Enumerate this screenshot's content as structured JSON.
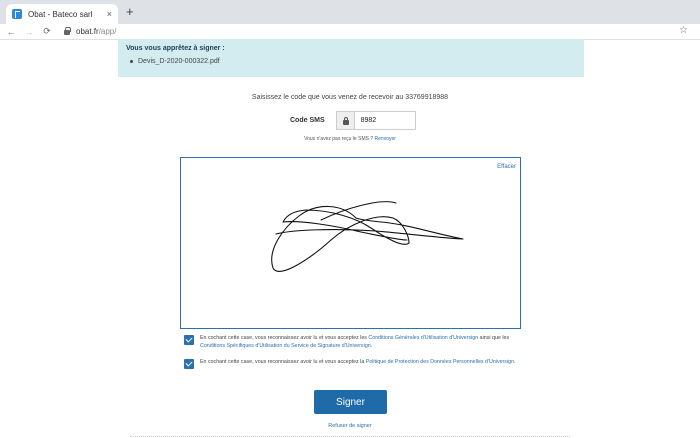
{
  "browser": {
    "tab_title": "Obat - Bateco sarl",
    "tab_close": "×",
    "new_tab": "+",
    "url_host": "obat.fr",
    "url_path": "/app/",
    "back": "←",
    "forward": "→",
    "reload": "⟳",
    "star": "☆"
  },
  "banner": {
    "title": "Vous vous apprêtez à signer :",
    "document": "Devis_D-2020-000322.pdf"
  },
  "sms": {
    "instruction": "Saisissez le code que vous venez de recevoir au 33769918988",
    "label": "Code SMS",
    "value": "8982",
    "not_received": "Vous n'avez pas reçu le SMS ?",
    "resend": "Renvoyer"
  },
  "signature": {
    "clear_label": "Effacer"
  },
  "consents": [
    {
      "checked": true,
      "text_before": "En cochant cette case, vous reconnaissez avoir lu et vous acceptez les ",
      "link1": "Conditions Générales d'Utilisation d'Universign",
      "text_middle": " ainsi que les ",
      "link2": "Conditions Spécifiques d'Utilisation du Service de Signature d'Universign",
      "text_after": "."
    },
    {
      "checked": true,
      "text_before": "En cochant cette case, vous reconnaissez avoir lu et vous acceptez la ",
      "link1": "Politique de Protection des Données Personnelles d'Universign",
      "text_after": "."
    }
  ],
  "actions": {
    "sign": "Signer",
    "refuse": "Refuser de signer"
  },
  "colors": {
    "accent": "#1f6aa8",
    "banner_bg": "#d3ecef",
    "link": "#2a6fb0"
  }
}
